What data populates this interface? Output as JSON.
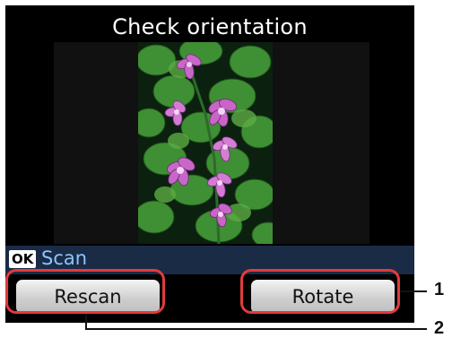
{
  "screen": {
    "title": "Check orientation",
    "ok_key": "OK",
    "ok_action": "Scan",
    "buttons": {
      "rescan": "Rescan",
      "rotate": "Rotate"
    }
  },
  "callouts": {
    "rotate_number": "1",
    "rescan_number": "2"
  },
  "colors": {
    "callout_ring": "#e23b3b",
    "lcd_background": "#000000",
    "ok_row_background": "#1a2b46",
    "ok_text": "#8fc4ff"
  }
}
